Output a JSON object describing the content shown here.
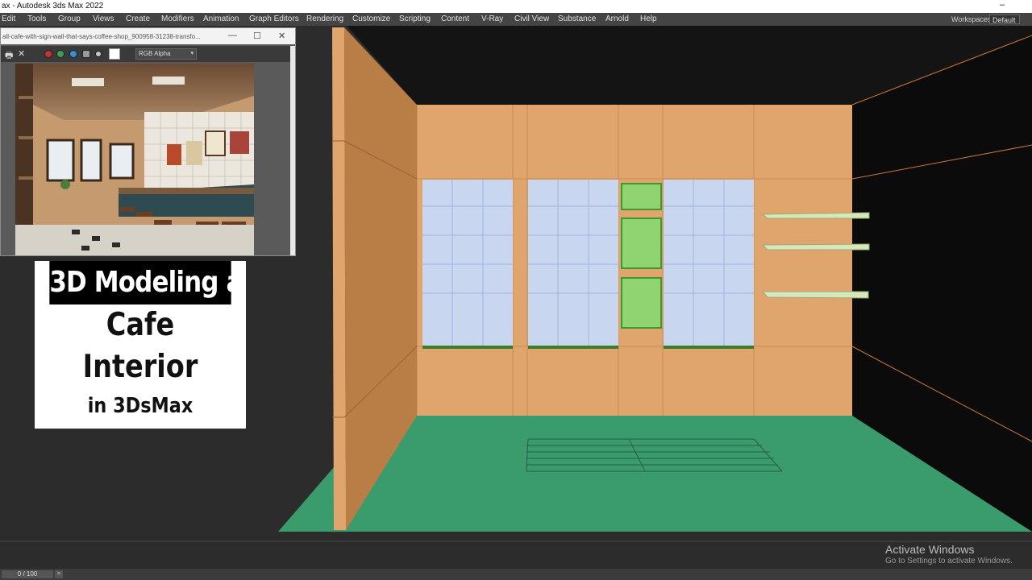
{
  "window": {
    "title": "ax - Autodesk 3ds Max 2022",
    "minimize_glyph": "–"
  },
  "menu": {
    "items": [
      "Edit",
      "Tools",
      "Group",
      "Views",
      "Create",
      "Modifiers",
      "Animation",
      "Graph Editors",
      "Rendering",
      "Customize",
      "Scripting",
      "Content",
      "V-Ray",
      "Civil View",
      "Substance",
      "Arnold",
      "Help"
    ],
    "workspaces_label": "Workspaces:",
    "workspaces_value": "Default"
  },
  "render_window": {
    "filename": "all-cafe-with-sign-wall-that-says-coffee-shop_900958-31238-transfo...",
    "minimize_glyph": "—",
    "maximize_glyph": "☐",
    "close_glyph": "✕",
    "channel": "RGB Alpha",
    "channel_arrow": "▾",
    "print_glyph": "🖶",
    "clear_glyph": "✕",
    "swatch_color": "#ffffff",
    "dot_colors": [
      "#c8342e",
      "#3aa050",
      "#3a8ed8",
      "#9a9a9a",
      "#c9c9c9"
    ]
  },
  "overlay": {
    "line1": "3D Modeling a",
    "line2": "Cafe",
    "line3": "Interior",
    "line4": "in 3DsMax"
  },
  "timeline": {
    "frame": "0 / 100",
    "next": ">"
  },
  "watermark": {
    "title": "Activate Windows",
    "subtitle": "Go to Settings to activate Windows."
  },
  "colors": {
    "wall": "#e0a56c",
    "floor": "#3a9b6d",
    "window_glass": "#c8d6ef",
    "panel_green": "#8fd470",
    "shelf": "#d8e7b8",
    "viewport_bg": "#2c2c2c"
  }
}
